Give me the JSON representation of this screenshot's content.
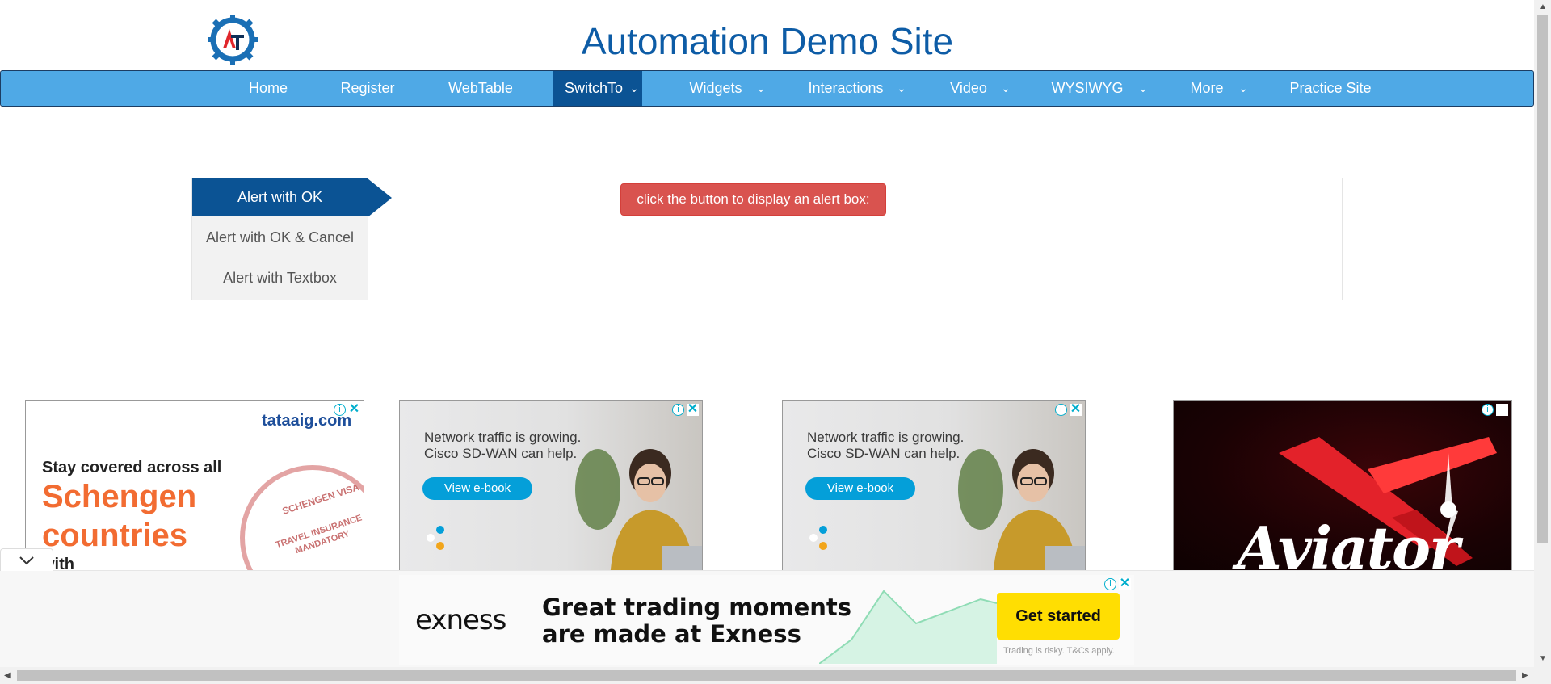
{
  "header": {
    "title": "Automation Demo Site",
    "logo_letters": "AT"
  },
  "nav": {
    "items": [
      {
        "label": "Home",
        "dropdown": false
      },
      {
        "label": "Register",
        "dropdown": false
      },
      {
        "label": "WebTable",
        "dropdown": false
      },
      {
        "label": "SwitchTo",
        "dropdown": true,
        "active": true
      },
      {
        "label": "Widgets",
        "dropdown": true
      },
      {
        "label": "Interactions",
        "dropdown": true
      },
      {
        "label": "Video",
        "dropdown": true
      },
      {
        "label": "WYSIWYG",
        "dropdown": true
      },
      {
        "label": "More",
        "dropdown": true
      },
      {
        "label": "Practice Site",
        "dropdown": false
      }
    ],
    "caret": "⌄"
  },
  "alerts": {
    "tabs": [
      {
        "label": "Alert with OK",
        "active": true
      },
      {
        "label": "Alert with OK & Cancel"
      },
      {
        "label": "Alert with Textbox"
      }
    ],
    "button_label": "click the button to display an alert box:"
  },
  "ads": {
    "adchoices_icon": "i",
    "close_icon": "✕",
    "tataaig": {
      "brand": "tataaig.com",
      "line1": "Stay covered across all",
      "big1": "Schengen",
      "big2": "countries",
      "line2": "with",
      "stamp_top": "SCHENGEN VISA",
      "stamp_bottom1": "TRAVEL INSURANCE",
      "stamp_bottom2": "MANDATORY",
      "stamp_side": "VISA"
    },
    "cisco": {
      "line1": "Network traffic is growing.",
      "line2": "Cisco SD-WAN can help.",
      "cta": "View e-book"
    },
    "aviator": {
      "word": "Aviator"
    },
    "exness": {
      "logo": "exness",
      "headline1": "Great trading moments",
      "headline2": "are made at Exness",
      "cta": "Get started",
      "disclaimer": "Trading is risky. T&Cs apply."
    }
  },
  "colors": {
    "title": "#0d5ca6",
    "nav_bg": "#4fa9e6",
    "nav_active": "#0b5394",
    "alert_button": "#d9534f"
  }
}
